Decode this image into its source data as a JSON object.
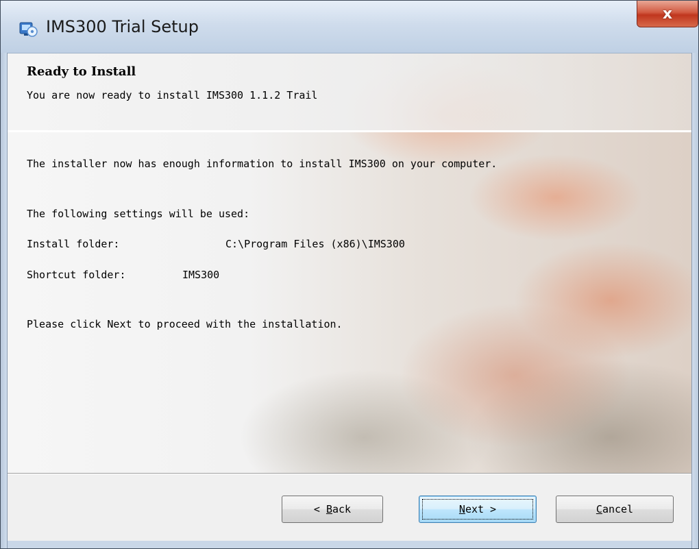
{
  "window": {
    "title": "IMS300 Trial Setup",
    "close_label": "x"
  },
  "header": {
    "title": "Ready to Install",
    "subtitle": "You are now ready to install IMS300 1.1.2 Trail"
  },
  "body": {
    "line1": "The installer now has enough information to install IMS300 on your computer.",
    "line2": "The following settings will be used:",
    "install_folder_label": "Install folder:",
    "install_folder_value": "C:\\Program Files (x86)\\IMS300",
    "shortcut_folder_label": "Shortcut folder:",
    "shortcut_folder_value": "IMS300",
    "line_proceed": "Please click Next to proceed with the installation."
  },
  "buttons": {
    "back": {
      "prefix": "< ",
      "mnemonic": "B",
      "rest": "ack"
    },
    "next": {
      "mnemonic": "N",
      "rest": "ext >"
    },
    "cancel": {
      "mnemonic": "C",
      "rest": "ancel"
    }
  }
}
